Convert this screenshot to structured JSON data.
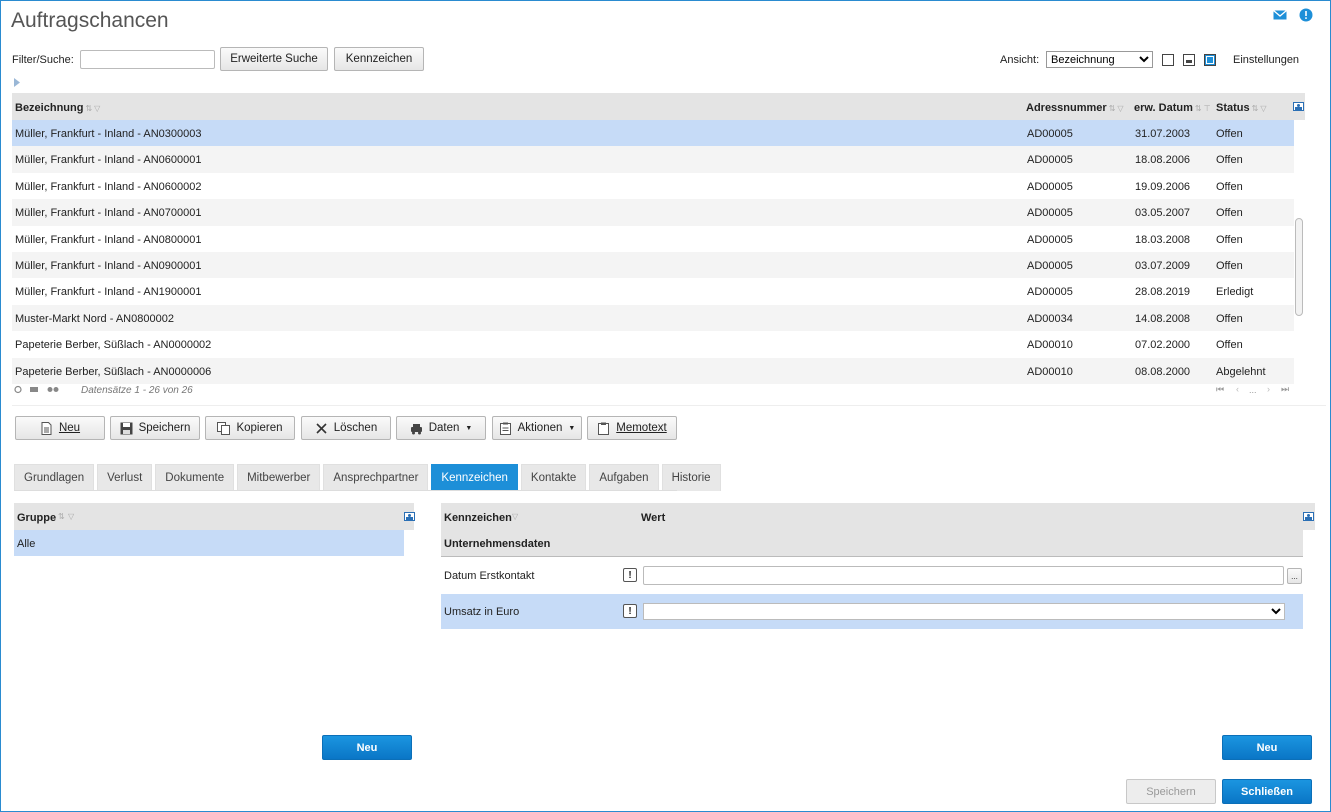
{
  "window": {
    "title": "Auftragschancen"
  },
  "toolbar": {
    "filter_label": "Filter/Suche:",
    "filter_value": "",
    "advanced_search": "Erweiterte Suche",
    "kennzeichen": "Kennzeichen",
    "view_label": "Ansicht:",
    "view_selected": "Bezeichnung",
    "settings": "Einstellungen"
  },
  "grid": {
    "columns": [
      "Bezeichnung",
      "Adressnummer",
      "erw. Datum",
      "Status"
    ],
    "rows": [
      [
        "Müller, Frankfurt - Inland - AN0300003",
        "AD00005",
        "31.07.2003",
        "Offen"
      ],
      [
        "Müller, Frankfurt - Inland - AN0600001",
        "AD00005",
        "18.08.2006",
        "Offen"
      ],
      [
        "Müller, Frankfurt - Inland - AN0600002",
        "AD00005",
        "19.09.2006",
        "Offen"
      ],
      [
        "Müller, Frankfurt - Inland - AN0700001",
        "AD00005",
        "03.05.2007",
        "Offen"
      ],
      [
        "Müller, Frankfurt - Inland - AN0800001",
        "AD00005",
        "18.03.2008",
        "Offen"
      ],
      [
        "Müller, Frankfurt - Inland - AN0900001",
        "AD00005",
        "03.07.2009",
        "Offen"
      ],
      [
        "Müller, Frankfurt - Inland - AN1900001",
        "AD00005",
        "28.08.2019",
        "Erledigt"
      ],
      [
        "Muster-Markt Nord - AN0800002",
        "AD00034",
        "14.08.2008",
        "Offen"
      ],
      [
        "Papeterie Berber, Süßlach - AN0000002",
        "AD00010",
        "07.02.2000",
        "Offen"
      ],
      [
        "Papeterie Berber, Süßlach - AN0000006",
        "AD00010",
        "08.08.2000",
        "Abgelehnt"
      ]
    ],
    "records_info": "Datensätze 1 - 26 von 26",
    "pager_ellipsis": "..."
  },
  "actions": {
    "new": "Neu",
    "save": "Speichern",
    "copy": "Kopieren",
    "delete": "Löschen",
    "data": "Daten",
    "actions": "Aktionen",
    "memo": "Memotext"
  },
  "tabs": [
    "Grundlagen",
    "Verlust",
    "Dokumente",
    "Mitbewerber",
    "Ansprechpartner",
    "Kennzeichen",
    "Kontakte",
    "Aufgaben",
    "Historie"
  ],
  "left_panel": {
    "header": "Gruppe",
    "items": [
      "Alle"
    ],
    "new_button": "Neu"
  },
  "right_panel": {
    "col_kennzeichen": "Kennzeichen",
    "col_wert": "Wert",
    "group": "Unternehmensdaten",
    "fields": [
      {
        "label": "Datum Erstkontakt",
        "value": "",
        "ellipsis": "..."
      },
      {
        "label": "Umsatz in Euro",
        "value": ""
      }
    ],
    "excl": "!",
    "new_button": "Neu"
  },
  "footer": {
    "save": "Speichern",
    "close": "Schließen"
  },
  "colors": {
    "accent": "#1d8fd8",
    "selected_row": "#c6dbf7"
  }
}
